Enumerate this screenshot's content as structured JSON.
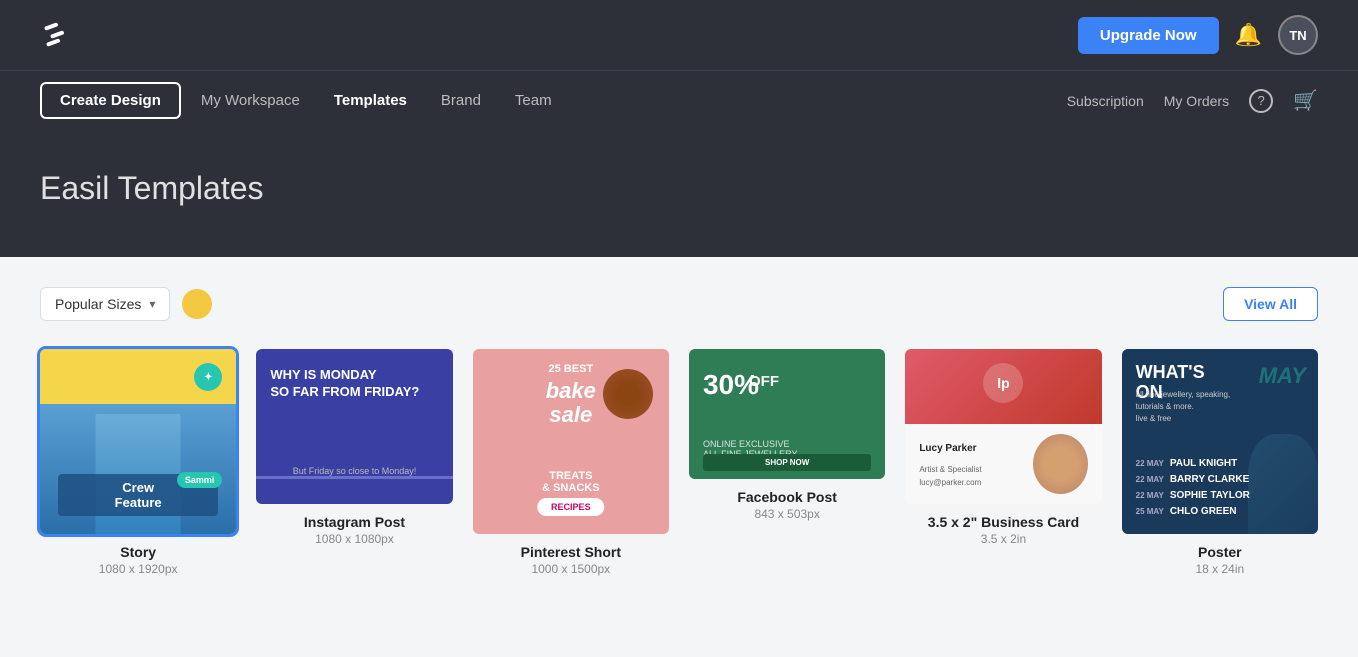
{
  "header": {
    "logo_alt": "Easil Logo",
    "upgrade_label": "Upgrade Now",
    "bell_icon": "🔔",
    "avatar_initials": "TN"
  },
  "navbar": {
    "create_design_label": "Create Design",
    "nav_items": [
      {
        "id": "my-workspace",
        "label": "My Workspace",
        "active": false
      },
      {
        "id": "templates",
        "label": "Templates",
        "active": true
      },
      {
        "id": "brand",
        "label": "Brand",
        "active": false
      },
      {
        "id": "team",
        "label": "Team",
        "active": false
      }
    ],
    "right_links": [
      {
        "id": "subscription",
        "label": "Subscription"
      },
      {
        "id": "my-orders",
        "label": "My Orders"
      }
    ],
    "help_icon": "?",
    "cart_icon": "🛒"
  },
  "hero": {
    "title": "Easil Templates"
  },
  "toolbar": {
    "popular_sizes_label": "Popular Sizes",
    "view_all_label": "View All"
  },
  "templates": [
    {
      "id": "story",
      "name": "Story",
      "size": "1080 x 1920px",
      "selected": true
    },
    {
      "id": "instagram-post",
      "name": "Instagram Post",
      "size": "1080 x 1080px",
      "selected": false
    },
    {
      "id": "pinterest-short",
      "name": "Pinterest Short",
      "size": "1000 x 1500px",
      "selected": false
    },
    {
      "id": "facebook-post",
      "name": "Facebook Post",
      "size": "843 x 503px",
      "selected": false
    },
    {
      "id": "business-card",
      "name": "3.5 x 2\" Business Card",
      "size": "3.5 x 2in",
      "selected": false
    },
    {
      "id": "poster",
      "name": "Poster",
      "size": "18 x 24in",
      "selected": false
    }
  ]
}
